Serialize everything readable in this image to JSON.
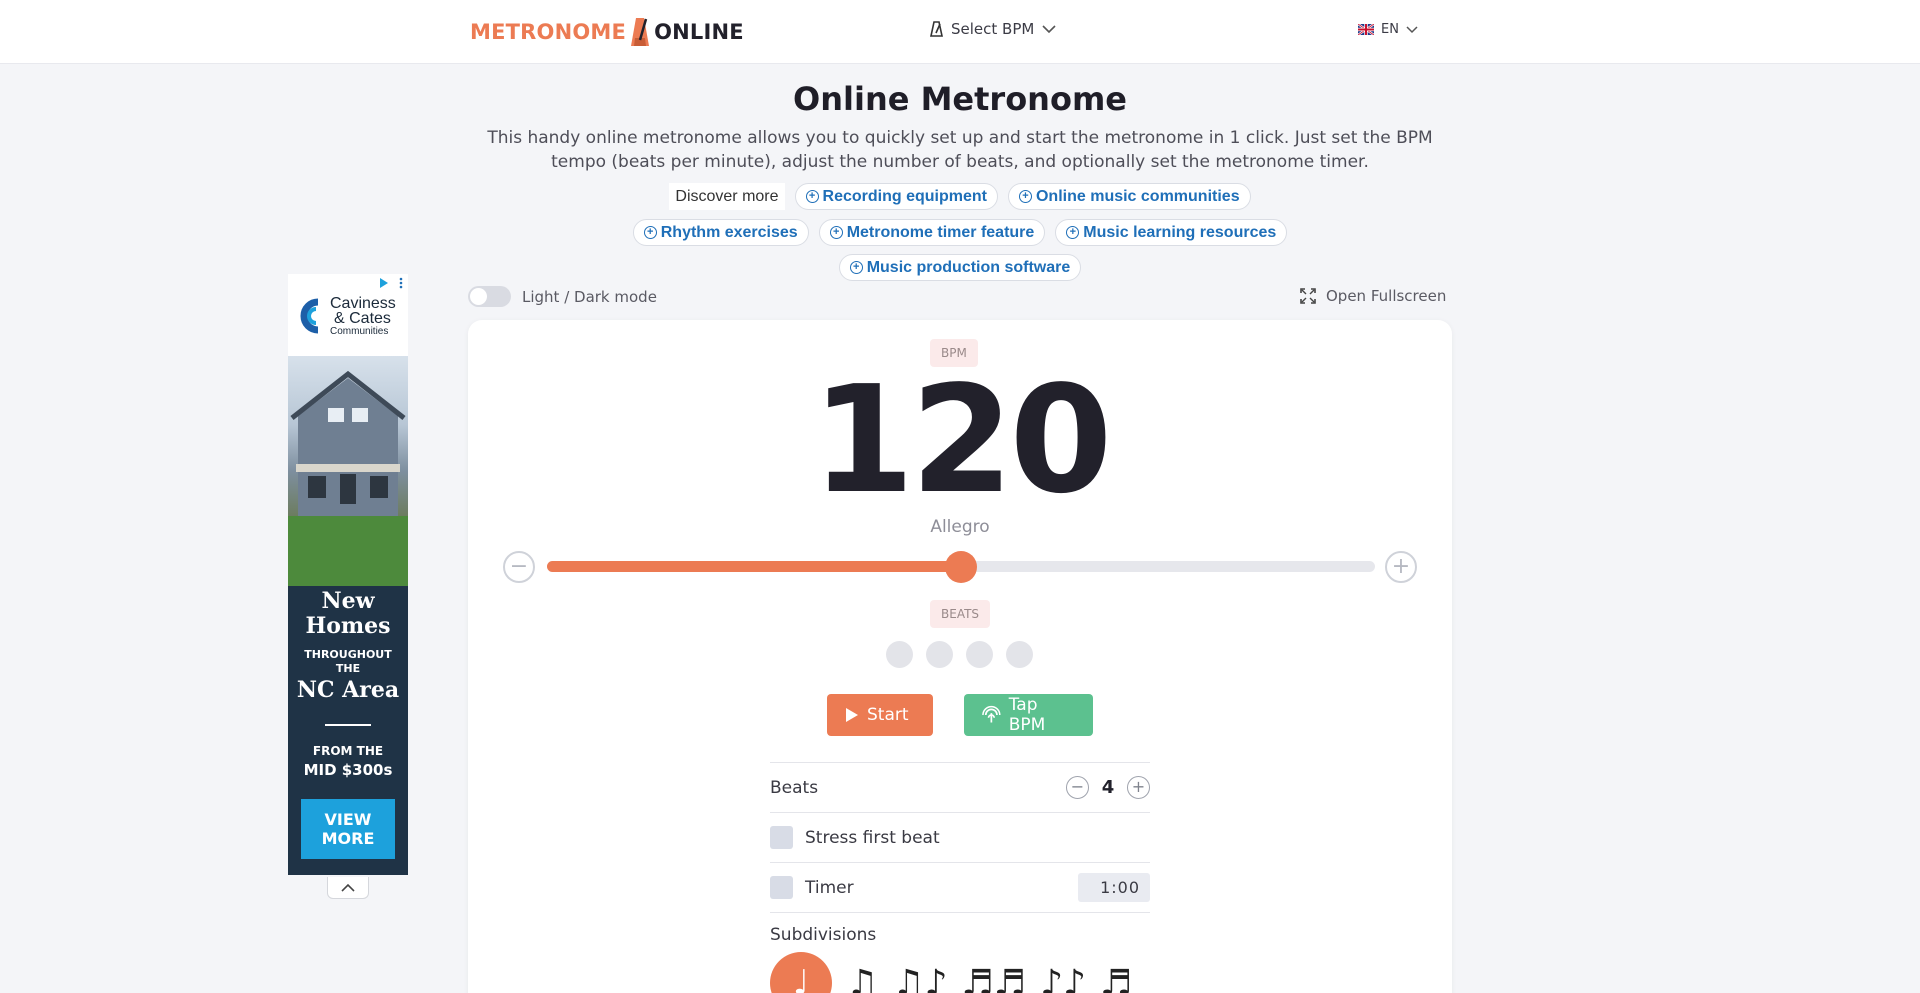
{
  "header": {
    "logo_left": "METRONOME",
    "logo_right": "ONLINE",
    "select_bpm": "Select BPM",
    "language": "EN"
  },
  "main": {
    "title": "Online Metronome",
    "intro": "This handy online metronome allows you to quickly set up and start the metronome in 1 click. Just set the BPM tempo (beats per minute), adjust the number of beats, and optionally set the metronome timer."
  },
  "discover": {
    "label": "Discover more",
    "chips": [
      "Recording equipment",
      "Online music communities",
      "Rhythm exercises",
      "Metronome timer feature",
      "Music learning resources",
      "Music production software"
    ]
  },
  "ad": {
    "brand_line1": "Caviness",
    "brand_line2": "& Cates",
    "brand_line3": "Communities",
    "headline1": "New",
    "headline2": "Homes",
    "sub1": "THROUGHOUT",
    "sub2": "THE",
    "region": "NC Area",
    "from": "FROM THE",
    "price": "MID $300s",
    "cta_line1": "VIEW",
    "cta_line2": "MORE"
  },
  "controls": {
    "mode_label": "Light / Dark mode",
    "fullscreen_label": "Open Fullscreen",
    "bpm_label": "BPM",
    "bpm_value": "120",
    "tempo_name": "Allegro",
    "bpm_slider_percent": 50,
    "beats_label": "BEATS",
    "start_label": "Start",
    "tap_label": "Tap BPM"
  },
  "settings": {
    "beats_label": "Beats",
    "beats_value": "4",
    "stress_label": "Stress first beat",
    "timer_label": "Timer",
    "timer_value": "1:00",
    "subdivisions_label": "Subdivisions",
    "subdivision_icons": [
      "quarter-note-icon",
      "eighth-notes-icon",
      "triplet-icon",
      "sixteenth-notes-icon",
      "dotted-eighth-icon",
      "dotted-sixteenth-icon"
    ]
  },
  "colors": {
    "accent": "#ec7b53",
    "tap": "#5cc18f",
    "link": "#1f6fb8"
  }
}
